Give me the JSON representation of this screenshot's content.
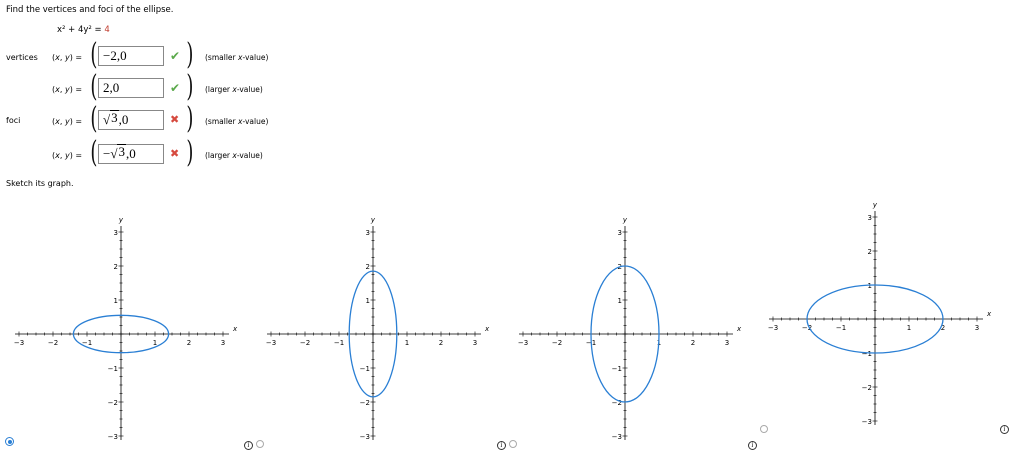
{
  "prompt": "Find the vertices and foci of the ellipse.",
  "equation": {
    "lhs": "x² + 4y² = ",
    "rhs": "4"
  },
  "sections": {
    "vertices": "vertices",
    "foci": "foci"
  },
  "xy_label": {
    "pre": "(",
    "x": "x",
    "mid": ", ",
    "y": "y",
    "post": ") ="
  },
  "answers": [
    {
      "value": "−2,0",
      "status": "correct",
      "hint_pre": "(smaller ",
      "hint_var": "x",
      "hint_post": "-value)"
    },
    {
      "value": "2,0",
      "status": "correct",
      "hint_pre": "(larger ",
      "hint_var": "x",
      "hint_post": "-value)"
    },
    {
      "value_sqrt": "3",
      "value_rest": ",0",
      "status": "incorrect",
      "hint_pre": "(smaller ",
      "hint_var": "x",
      "hint_post": "-value)"
    },
    {
      "value_pre": "−",
      "value_sqrt": "3",
      "value_rest": ",0",
      "status": "incorrect",
      "hint_pre": "(larger ",
      "hint_var": "x",
      "hint_post": "-value)"
    }
  ],
  "status_icons": {
    "correct": "check-icon",
    "incorrect": "cross-icon"
  },
  "sketch_prompt": "Sketch its graph.",
  "graphs": [
    {
      "a": 1.4,
      "b": 0.55,
      "xlim": [
        -3,
        3
      ],
      "ylim": [
        -3,
        3
      ],
      "selected": true,
      "status": "none"
    },
    {
      "a": 0.7,
      "b": 1.85,
      "xlim": [
        -3,
        3
      ],
      "ylim": [
        -3,
        3
      ],
      "selected": false,
      "status": "none"
    },
    {
      "a": 1.0,
      "b": 2.0,
      "xlim": [
        -3,
        3
      ],
      "ylim": [
        -3,
        3
      ],
      "selected": false,
      "status": "incorrect"
    },
    {
      "a": 2.0,
      "b": 1.0,
      "xlim": [
        -3,
        3
      ],
      "ylim": [
        -3,
        3
      ],
      "selected": false,
      "status": "none"
    }
  ],
  "axis_labels": {
    "x": "x",
    "y": "y"
  },
  "ticks": [
    "-3",
    "-2",
    "-1",
    "1",
    "2",
    "3"
  ],
  "yticks": [
    "3",
    "2",
    "1",
    "-1",
    "-2",
    "-3"
  ],
  "info_glyph": "i",
  "colors": {
    "ellipse": "#2a7fd4",
    "check": "#5aa94a",
    "cross": "#d64a3f",
    "equation_accent": "#c0392b"
  }
}
